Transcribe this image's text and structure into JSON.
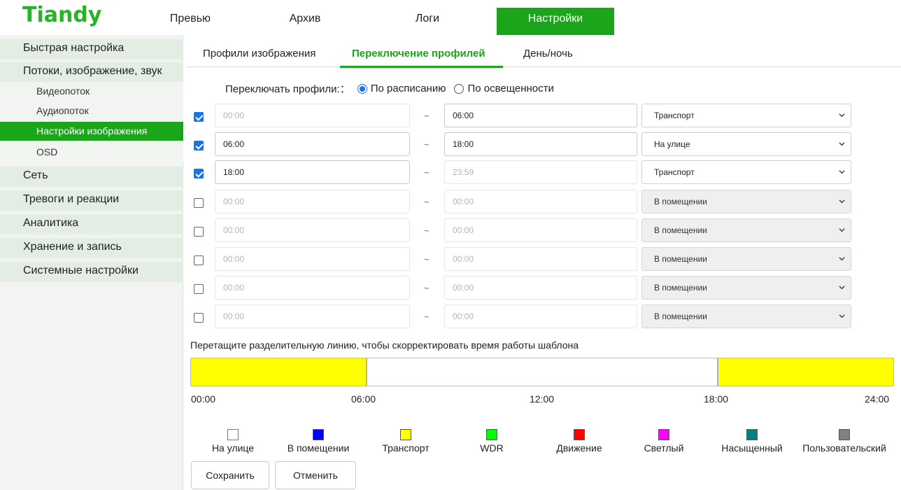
{
  "app": {
    "logo": "Tiandy"
  },
  "nav": {
    "tabs": [
      {
        "label": "Превью"
      },
      {
        "label": "Архив"
      },
      {
        "label": "Логи"
      },
      {
        "label": "Настройки",
        "active": true
      }
    ]
  },
  "sidebar": {
    "quick": "Быстрая настройка",
    "streams": "Потоки, изображение, звук",
    "sub": [
      {
        "label": "Видеопоток"
      },
      {
        "label": "Аудиопоток"
      },
      {
        "label": "Настройки изображения",
        "active": true
      },
      {
        "label": "OSD"
      }
    ],
    "network": "Сеть",
    "alarms": "Тревоги и реакции",
    "analytics": "Аналитика",
    "storage": "Хранение и запись",
    "system": "Системные настройки"
  },
  "subtabs": {
    "profiles": "Профили изображения",
    "switching": "Переключение профилей",
    "daynight": "День/ночь"
  },
  "mode": {
    "label": "Переключать профили:：",
    "by_schedule": "По расписанию",
    "by_light": "По освещенности",
    "selected": "by_schedule"
  },
  "schedule": {
    "tilde": "~",
    "rows": [
      {
        "checked": true,
        "start": "00:00",
        "end": "06:00",
        "profile": "Транспорт"
      },
      {
        "checked": true,
        "start": "06:00",
        "end": "18:00",
        "profile": "На улице"
      },
      {
        "checked": true,
        "start": "18:00",
        "end": "23:59",
        "profile": "Транспорт"
      },
      {
        "checked": false,
        "start": "00:00",
        "end": "00:00",
        "profile": "В помещении"
      },
      {
        "checked": false,
        "start": "00:00",
        "end": "00:00",
        "profile": "В помещении"
      },
      {
        "checked": false,
        "start": "00:00",
        "end": "00:00",
        "profile": "В помещении"
      },
      {
        "checked": false,
        "start": "00:00",
        "end": "00:00",
        "profile": "В помещении"
      },
      {
        "checked": false,
        "start": "00:00",
        "end": "00:00",
        "profile": "В помещении"
      }
    ]
  },
  "timeline": {
    "hint": "Перетащите разделительную линию, чтобы скорректировать время работы шаблона",
    "ticks": [
      "00:00",
      "06:00",
      "12:00",
      "18:00",
      "24:00"
    ],
    "segments": [
      {
        "from_hour": 0,
        "to_hour": 6,
        "color": "#ffff00"
      },
      {
        "from_hour": 6,
        "to_hour": 18,
        "color": "#ffffff"
      },
      {
        "from_hour": 18,
        "to_hour": 24,
        "color": "#ffff00"
      }
    ]
  },
  "legend": [
    {
      "label": "На улице",
      "color": "#ffffff"
    },
    {
      "label": "В помещении",
      "color": "#0000ff"
    },
    {
      "label": "Транспорт",
      "color": "#ffff00"
    },
    {
      "label": "WDR",
      "color": "#00ff00"
    },
    {
      "label": "Движение",
      "color": "#ff0000"
    },
    {
      "label": "Светлый",
      "color": "#ff00ff"
    },
    {
      "label": "Насыщенный",
      "color": "#008080"
    },
    {
      "label": "Пользовательский",
      "color": "#808080"
    }
  ],
  "actions": {
    "save": "Сохранить",
    "cancel": "Отменить"
  },
  "colors": {
    "accent": "#1aa51a",
    "logo": "#27b327",
    "check": "#1a73e8"
  }
}
